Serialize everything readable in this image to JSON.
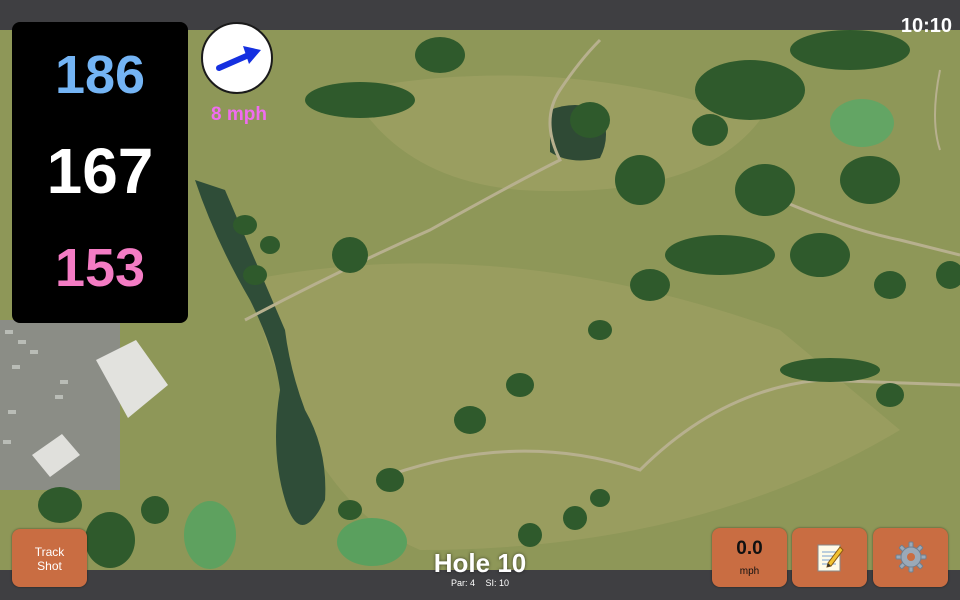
{
  "status_bar": {
    "time": "10:10"
  },
  "distances": {
    "back": "186",
    "middle": "167",
    "front": "153"
  },
  "wind": {
    "speed": "8 mph",
    "direction_icon": "arrow-icon"
  },
  "track_shot": {
    "label": "Track\nShot"
  },
  "speed_panel": {
    "value": "0.0",
    "unit": "mph"
  },
  "hole": {
    "title": "Hole 10",
    "par": "Par: 4",
    "si": "SI: 10"
  },
  "icons": {
    "notes": "notepad-icon",
    "settings": "gear-icon"
  },
  "colors": {
    "back_distance": "#74b4f4",
    "middle_distance": "#ffffff",
    "front_distance": "#f47cc4",
    "wind_speed": "#f06cf0",
    "button": "#c96d42",
    "wind_arrow": "#1530e0"
  }
}
